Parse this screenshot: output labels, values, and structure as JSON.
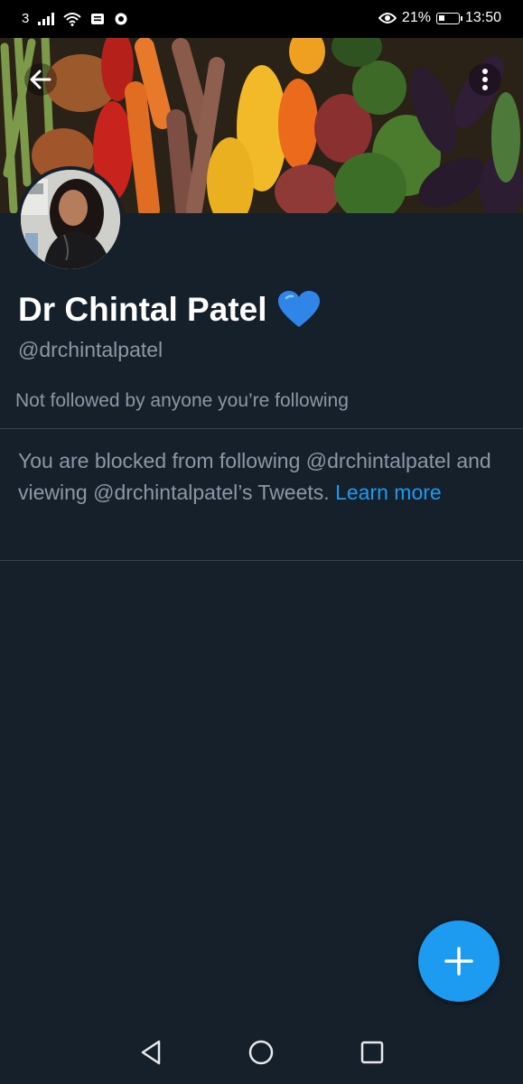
{
  "status_bar": {
    "carrier_signal": "3",
    "battery_percent": "21%",
    "time": "13:50",
    "icons": [
      "signal-icon",
      "wifi-icon",
      "notification-icon",
      "chat-icon",
      "eye-icon",
      "battery-icon"
    ]
  },
  "profile": {
    "display_name": "Dr Chintal Patel",
    "name_emoji": "💙",
    "handle": "@drchintalpatel",
    "followers_note": "Not followed by anyone you’re following"
  },
  "blocked_notice": {
    "text": "You are blocked from following @drchintalpatel and viewing @drchintalpatel’s Tweets. ",
    "link_label": "Learn more"
  },
  "actions": {
    "back_icon": "back-arrow-icon",
    "more_icon": "more-vertical-icon",
    "compose_icon": "plus-icon"
  },
  "nav_bar": {
    "icons": [
      "nav-back-icon",
      "nav-home-icon",
      "nav-recents-icon"
    ]
  },
  "colors": {
    "background": "#15202b",
    "accent": "#1d9bf0",
    "secondary_text": "#8b98a5",
    "divider": "#38444d"
  }
}
